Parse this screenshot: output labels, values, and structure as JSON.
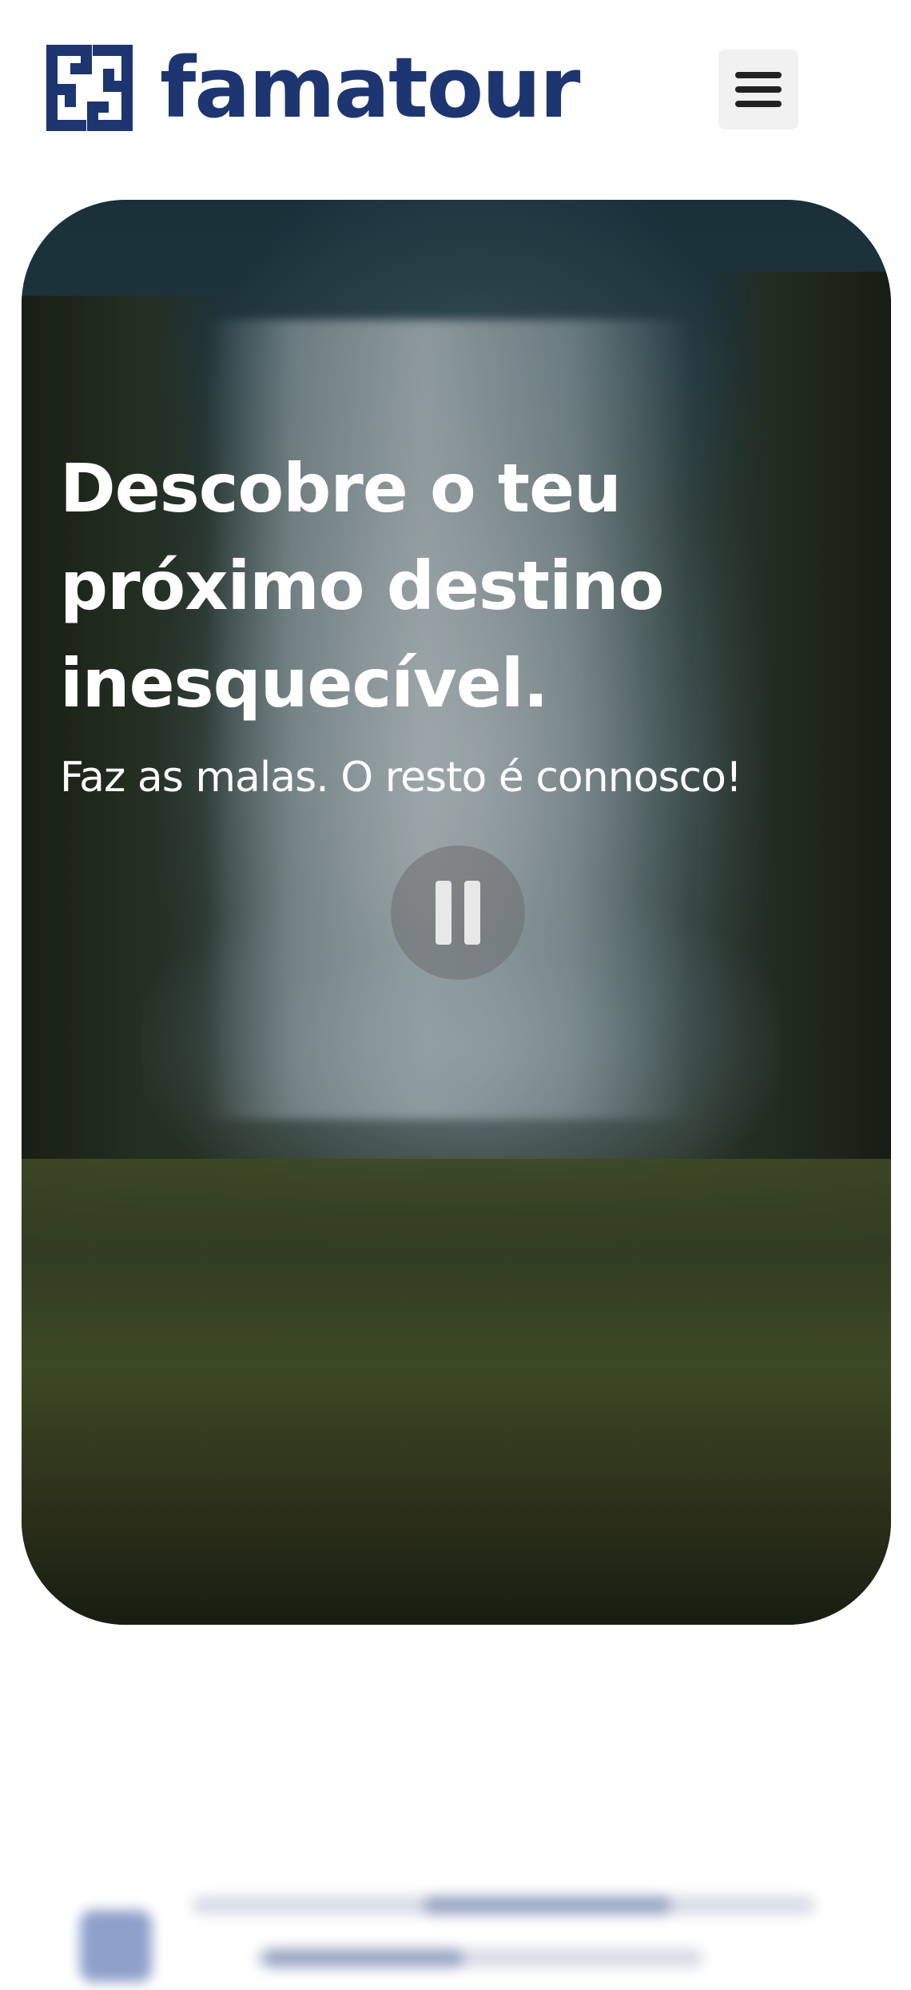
{
  "header": {
    "brand_name": "famatour",
    "logo_icon": "famatour-logo-mark",
    "menu_icon": "hamburger-menu-icon",
    "brand_color": "#1d3570"
  },
  "hero": {
    "title": "Descobre o teu próximo destino inesquecível.",
    "subtitle": "Faz as malas. O resto é connosco!",
    "video_control_icon": "pause-icon",
    "background": "waterfall video"
  }
}
